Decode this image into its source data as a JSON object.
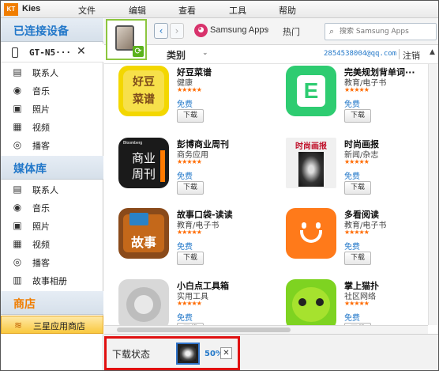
{
  "titlebar": {
    "logo_text": "KT",
    "app_name": "Kies",
    "menu": [
      "文件",
      "编辑",
      "查看",
      "工具",
      "帮助"
    ]
  },
  "sidebar": {
    "connected_header": "已连接设备",
    "device_name": "GT-N5···",
    "device_close": "✕",
    "device_items": [
      {
        "label": "联系人",
        "icon": "contacts-icon"
      },
      {
        "label": "音乐",
        "icon": "music-icon"
      },
      {
        "label": "照片",
        "icon": "photo-icon"
      },
      {
        "label": "视频",
        "icon": "video-icon"
      },
      {
        "label": "播客",
        "icon": "podcast-icon"
      }
    ],
    "library_header": "媒体库",
    "library_items": [
      {
        "label": "联系人",
        "icon": "contacts-icon"
      },
      {
        "label": "音乐",
        "icon": "music-icon"
      },
      {
        "label": "照片",
        "icon": "photo-icon"
      },
      {
        "label": "视频",
        "icon": "video-icon"
      },
      {
        "label": "播客",
        "icon": "podcast-icon"
      },
      {
        "label": "故事相册",
        "icon": "story-album-icon"
      }
    ],
    "store_header": "商店",
    "store_item": "三星应用商店"
  },
  "toolbar": {
    "back": "‹",
    "forward": "›",
    "sa_badge": "◕",
    "sa_label": "Samsung Apps",
    "crumb_sep": "›",
    "crumb_current": "热门",
    "search_placeholder": "搜索 Samsung Apps"
  },
  "subbar": {
    "category": "类别",
    "category_arrow": "⌄",
    "account": "2854538004@qq.com",
    "logout": "注销",
    "scroll": "▲"
  },
  "apps": [
    {
      "name": "好豆菜谱",
      "category": "健康",
      "stars": "★★★★★",
      "price": "免费",
      "download": "下载",
      "icon_colors": [
        "#f3d700",
        "#7d4a1a"
      ],
      "icon_text": "好豆\n菜谱"
    },
    {
      "name": "完美规划背单词···",
      "category": "教育/电子书",
      "stars": "★★★★★",
      "price": "免费",
      "download": "下载",
      "icon_colors": [
        "#2ecc71",
        "#fff"
      ],
      "icon_text": "E"
    },
    {
      "name": "彭博商业周刊",
      "category": "商务应用",
      "stars": "★★★★★",
      "price": "免费",
      "download": "下载",
      "icon_colors": [
        "#1a1a1a",
        "#fff"
      ],
      "icon_text": "商业\n周刊"
    },
    {
      "name": "时尚画报",
      "category": "新闻/杂志",
      "stars": "★★★★★",
      "price": "免费",
      "download": "下载",
      "icon_colors": [
        "#e8e8e8",
        "#c0102a"
      ],
      "icon_text": "时尚画报"
    },
    {
      "name": "故事口袋-读读",
      "category": "教育/电子书",
      "stars": "★★★★★",
      "price": "免费",
      "download": "下载",
      "icon_colors": [
        "#c4681a",
        "#fff"
      ],
      "icon_text": "故事"
    },
    {
      "name": "多看阅读",
      "category": "教育/电子书",
      "stars": "★★★★★",
      "price": "免费",
      "download": "下载",
      "icon_colors": [
        "#ff7a1a",
        "#fff"
      ],
      "icon_text": "◡"
    },
    {
      "name": "小白点工具箱",
      "category": "实用工具",
      "stars": "★★★★★",
      "price": "免费",
      "download": "下载",
      "icon_colors": [
        "#dcdcdc",
        "#aaa"
      ],
      "icon_text": ""
    },
    {
      "name": "掌上猫扑",
      "category": "社区网络",
      "stars": "★★★★★",
      "price": "免费",
      "download": "下载",
      "icon_colors": [
        "#7ed321",
        "#222"
      ],
      "icon_text": "☺"
    }
  ],
  "download_bar": {
    "label": "下载状态",
    "percent": "50%",
    "close": "✕"
  }
}
